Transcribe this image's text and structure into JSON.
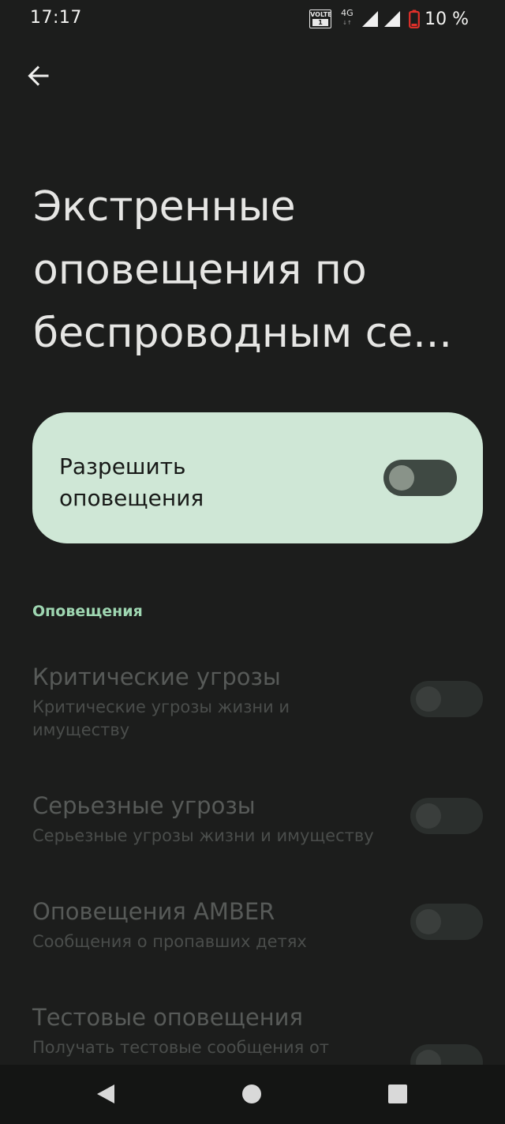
{
  "status_bar": {
    "time": "17:17",
    "volte_top": "VOLTE",
    "volte_bottom": "1",
    "network_type": "4G",
    "network_arrows": "↓↑",
    "battery_text": "10 %",
    "battery_color": "#e0302a"
  },
  "page": {
    "title": "Экстренные оповещения по беспроводным се..."
  },
  "main_toggle": {
    "label": "Разрешить оповещения",
    "checked": false
  },
  "section": {
    "header": "Оповещения"
  },
  "alerts": [
    {
      "title": "Критические угрозы",
      "summary": "Критические угрозы жизни и имуществу",
      "checked": false,
      "enabled": false
    },
    {
      "title": "Серьезные угрозы",
      "summary": "Серьезные угрозы жизни и имуществу",
      "checked": false,
      "enabled": false
    },
    {
      "title": "Оповещения AMBER",
      "summary": "Сообщения о пропавших детях",
      "checked": false,
      "enabled": false
    },
    {
      "title": "Тестовые оповещения",
      "summary": "Получать тестовые сообщения от",
      "checked": false,
      "enabled": false
    }
  ],
  "colors": {
    "background": "#1c1d1c",
    "card": "#cfe7d6",
    "accent": "#9ed6b1"
  },
  "icons": {
    "back": "arrow-left-icon",
    "nav_back": "triangle-back-icon",
    "nav_home": "circle-home-icon",
    "nav_recents": "square-recents-icon"
  }
}
